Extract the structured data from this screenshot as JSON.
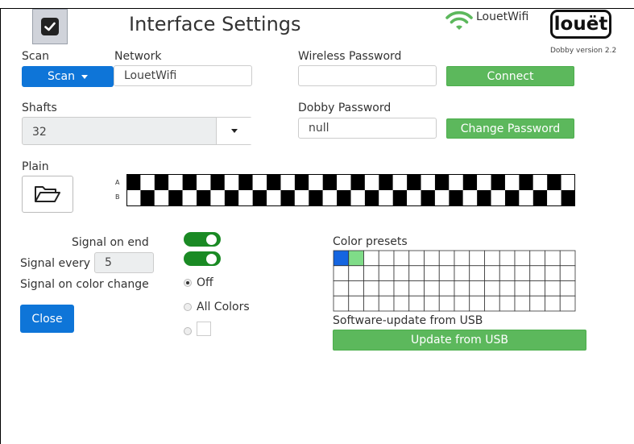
{
  "header": {
    "title": "Interface Settings",
    "wifi_name": "LouetWifi",
    "logo": "louët",
    "version": "Dobby version 2.2"
  },
  "scan": {
    "label": "Scan",
    "button_label": "Scan",
    "network_label": "Network",
    "network_value": "LouetWifi"
  },
  "wireless": {
    "label": "Wireless Password",
    "value": "",
    "connect_label": "Connect"
  },
  "shafts": {
    "label": "Shafts",
    "value": "32"
  },
  "dobby": {
    "label": "Dobby Password",
    "value": "null",
    "change_label": "Change Password"
  },
  "plain": {
    "label": "Plain",
    "row_a_label": "A",
    "row_b_label": "B",
    "cells": 32,
    "row_a_starts_black": true
  },
  "signal": {
    "on_end_label": "Signal on end",
    "on_end_enabled": true,
    "every_label": "Signal every",
    "every_value": "5",
    "every_enabled": true,
    "color_change_label": "Signal on color change",
    "options": [
      {
        "label": "Off",
        "selected": true
      },
      {
        "label": "All Colors",
        "selected": false
      },
      {
        "label": "",
        "selected": false
      }
    ]
  },
  "close_label": "Close",
  "presets": {
    "label": "Color presets",
    "columns": 16,
    "rows": 4,
    "colors": [
      "#1565e0",
      "#7fdc88"
    ]
  },
  "update": {
    "label": "Software-update from USB",
    "button_label": "Update from USB"
  },
  "colors": {
    "primary_blue": "#0e75d8",
    "green": "#5cb85c",
    "toggle_green": "#1a8a24"
  }
}
